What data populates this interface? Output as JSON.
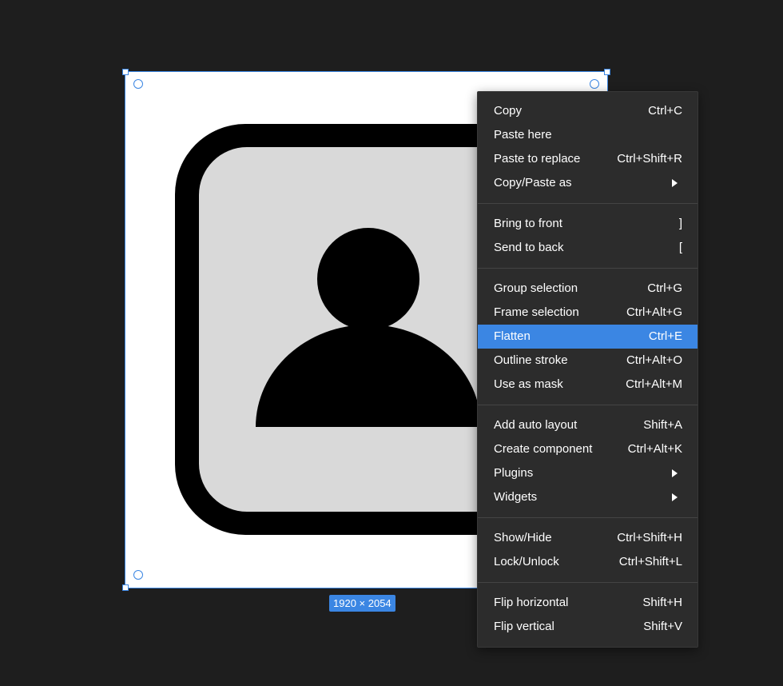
{
  "canvas": {
    "frame_size_label": "1920 × 2054"
  },
  "context_menu": {
    "groups": [
      [
        {
          "label": "Copy",
          "shortcut": "Ctrl+C"
        },
        {
          "label": "Paste here",
          "shortcut": ""
        },
        {
          "label": "Paste to replace",
          "shortcut": "Ctrl+Shift+R"
        },
        {
          "label": "Copy/Paste as",
          "shortcut": "",
          "submenu": true
        }
      ],
      [
        {
          "label": "Bring to front",
          "shortcut": "]"
        },
        {
          "label": "Send to back",
          "shortcut": "["
        }
      ],
      [
        {
          "label": "Group selection",
          "shortcut": "Ctrl+G"
        },
        {
          "label": "Frame selection",
          "shortcut": "Ctrl+Alt+G"
        },
        {
          "label": "Flatten",
          "shortcut": "Ctrl+E",
          "highlighted": true
        },
        {
          "label": "Outline stroke",
          "shortcut": "Ctrl+Alt+O"
        },
        {
          "label": "Use as mask",
          "shortcut": "Ctrl+Alt+M"
        }
      ],
      [
        {
          "label": "Add auto layout",
          "shortcut": "Shift+A"
        },
        {
          "label": "Create component",
          "shortcut": "Ctrl+Alt+K"
        },
        {
          "label": "Plugins",
          "shortcut": "",
          "submenu": true
        },
        {
          "label": "Widgets",
          "shortcut": "",
          "submenu": true
        }
      ],
      [
        {
          "label": "Show/Hide",
          "shortcut": "Ctrl+Shift+H"
        },
        {
          "label": "Lock/Unlock",
          "shortcut": "Ctrl+Shift+L"
        }
      ],
      [
        {
          "label": "Flip horizontal",
          "shortcut": "Shift+H"
        },
        {
          "label": "Flip vertical",
          "shortcut": "Shift+V"
        }
      ]
    ]
  },
  "colors": {
    "canvas_bg": "#1e1e1e",
    "menu_bg": "#2c2c2c",
    "selection": "#3b86e3",
    "highlight": "#3b86e3"
  }
}
